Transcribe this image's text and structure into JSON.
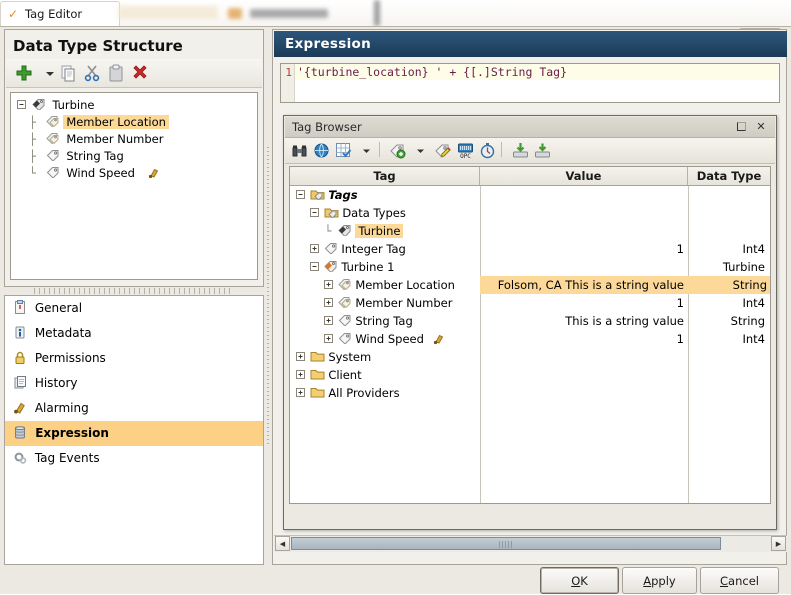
{
  "background": {
    "app_tab_label": "Tag Editor",
    "app_tab_icon": "wrench-icon"
  },
  "window": {
    "close_label": "✕",
    "close_icon": "close-icon"
  },
  "data_type_structure": {
    "title": "Data Type Structure",
    "toolbar": [
      {
        "name": "add-button",
        "icon": "green-plus-icon",
        "label": "+"
      },
      {
        "name": "add-dropdown-button",
        "icon": "chevron-down-icon",
        "label": "▾"
      },
      {
        "name": "copy-button",
        "icon": "copy-icon",
        "label": ""
      },
      {
        "name": "cut-button",
        "icon": "scissors-icon",
        "label": ""
      },
      {
        "name": "paste-button",
        "icon": "paste-icon",
        "label": ""
      },
      {
        "name": "delete-button",
        "icon": "red-x-icon",
        "label": "✖"
      }
    ],
    "tree": [
      {
        "label": "Turbine",
        "icon": "datatype-icon",
        "depth": 0,
        "expander": "minus",
        "selected": false,
        "alarm": false
      },
      {
        "label": "Member Location",
        "icon": "member-tag-icon",
        "depth": 1,
        "expander": "none",
        "selected": true,
        "alarm": false
      },
      {
        "label": "Member Number",
        "icon": "member-tag-icon",
        "depth": 1,
        "expander": "none",
        "selected": false,
        "alarm": false
      },
      {
        "label": "String Tag",
        "icon": "tag-icon",
        "depth": 1,
        "expander": "none",
        "selected": false,
        "alarm": false
      },
      {
        "label": "Wind Speed",
        "icon": "tag-icon",
        "depth": 1,
        "expander": "none",
        "selected": false,
        "alarm": true
      }
    ]
  },
  "nav": {
    "items": [
      {
        "label": "General",
        "icon": "clipboard-icon",
        "selected": false
      },
      {
        "label": "Metadata",
        "icon": "info-icon",
        "selected": false
      },
      {
        "label": "Permissions",
        "icon": "lock-icon",
        "selected": false
      },
      {
        "label": "History",
        "icon": "history-icon",
        "selected": false
      },
      {
        "label": "Alarming",
        "icon": "bell-icon",
        "selected": false
      },
      {
        "label": "Expression",
        "icon": "expression-icon",
        "selected": true
      },
      {
        "label": "Tag Events",
        "icon": "events-icon",
        "selected": false
      }
    ]
  },
  "expression_panel": {
    "header": "Expression",
    "line_number": "1",
    "code": "'{turbine_location} ' + {[.]String Tag}"
  },
  "tag_browser": {
    "title": "Tag Browser",
    "restore_label": "❏",
    "close_label": "✕",
    "toolbar": [
      {
        "name": "search-tags-button",
        "icon": "binoculars-icon"
      },
      {
        "name": "tag-provider-button",
        "icon": "globe-icon"
      },
      {
        "name": "tag-group-button",
        "icon": "grid-check-icon"
      },
      {
        "name": "tag-group-dropdown",
        "icon": "chevron-down-icon",
        "label": "▾"
      },
      {
        "name": "new-tag-button",
        "icon": "new-tag-icon"
      },
      {
        "name": "new-tag-dropdown",
        "icon": "chevron-down-icon",
        "label": "▾"
      },
      {
        "name": "edit-tag-button",
        "icon": "edit-tag-icon"
      },
      {
        "name": "opc-browser-button",
        "icon": "opc-icon",
        "label": "OPC"
      },
      {
        "name": "tag-history-button",
        "icon": "stopwatch-icon"
      },
      {
        "name": "import-tags-button",
        "icon": "import-icon"
      },
      {
        "name": "export-tags-button",
        "icon": "export-icon"
      }
    ],
    "columns": [
      "Tag",
      "Value",
      "Data Type"
    ],
    "rows": [
      {
        "tag": "Tags",
        "icon": "folder-tags-icon",
        "depth": 0,
        "expander": "minus",
        "value": "",
        "data_type": "",
        "selected": false,
        "italic": true,
        "alarm": false
      },
      {
        "tag": "Data Types",
        "icon": "folder-datatypes-icon",
        "depth": 1,
        "expander": "minus",
        "value": "",
        "data_type": "",
        "selected": false,
        "italic": false,
        "alarm": false
      },
      {
        "tag": "Turbine",
        "icon": "datatype-icon",
        "depth": 2,
        "expander": "none",
        "value": "",
        "data_type": "",
        "selected": true,
        "italic": false,
        "alarm": false
      },
      {
        "tag": "Integer Tag",
        "icon": "tag-icon",
        "depth": 1,
        "expander": "plus",
        "value": "1",
        "data_type": "Int4",
        "selected": false,
        "italic": false,
        "alarm": false
      },
      {
        "tag": "Turbine 1",
        "icon": "udt-instance-icon",
        "depth": 1,
        "expander": "minus",
        "value": "",
        "data_type": "Turbine",
        "selected": false,
        "italic": false,
        "alarm": false
      },
      {
        "tag": "Member Location",
        "icon": "member-tag-icon",
        "depth": 2,
        "expander": "plus",
        "value": "Folsom, CA This is a string value",
        "data_type": "String",
        "selected": false,
        "italic": false,
        "alarm": false,
        "highlight": true
      },
      {
        "tag": "Member Number",
        "icon": "member-tag-icon",
        "depth": 2,
        "expander": "plus",
        "value": "1",
        "data_type": "Int4",
        "selected": false,
        "italic": false,
        "alarm": false
      },
      {
        "tag": "String Tag",
        "icon": "tag-icon",
        "depth": 2,
        "expander": "plus",
        "value": "This is a string value",
        "data_type": "String",
        "selected": false,
        "italic": false,
        "alarm": false
      },
      {
        "tag": "Wind Speed",
        "icon": "tag-icon",
        "depth": 2,
        "expander": "plus",
        "value": "1",
        "data_type": "Int4",
        "selected": false,
        "italic": false,
        "alarm": true
      },
      {
        "tag": "System",
        "icon": "folder-icon",
        "depth": 0,
        "expander": "plus",
        "value": "",
        "data_type": "",
        "selected": false,
        "italic": false,
        "alarm": false
      },
      {
        "tag": "Client",
        "icon": "folder-icon",
        "depth": 0,
        "expander": "plus",
        "value": "",
        "data_type": "",
        "selected": false,
        "italic": false,
        "alarm": false
      },
      {
        "tag": "All Providers",
        "icon": "folder-icon",
        "depth": 0,
        "expander": "plus",
        "value": "",
        "data_type": "",
        "selected": false,
        "italic": false,
        "alarm": false
      }
    ],
    "scrollbar": {
      "left_arrow": "◀",
      "right_arrow": "▶"
    }
  },
  "footer": {
    "buttons": [
      {
        "name": "ok-button",
        "mnemonic": "O",
        "rest": "K",
        "focused": true
      },
      {
        "name": "apply-button",
        "mnemonic": "A",
        "rest": "pply",
        "focused": false
      },
      {
        "name": "cancel-button",
        "mnemonic": "C",
        "rest": "ancel",
        "focused": false
      }
    ]
  },
  "colors": {
    "header_navy": "#1b3c57",
    "selection_orange": "#fcd186",
    "highlight_orange": "#fcd998",
    "code_purple": "#6a1b4d",
    "line_number_red": "#c0392b",
    "window_bg": "#ece9e2"
  }
}
